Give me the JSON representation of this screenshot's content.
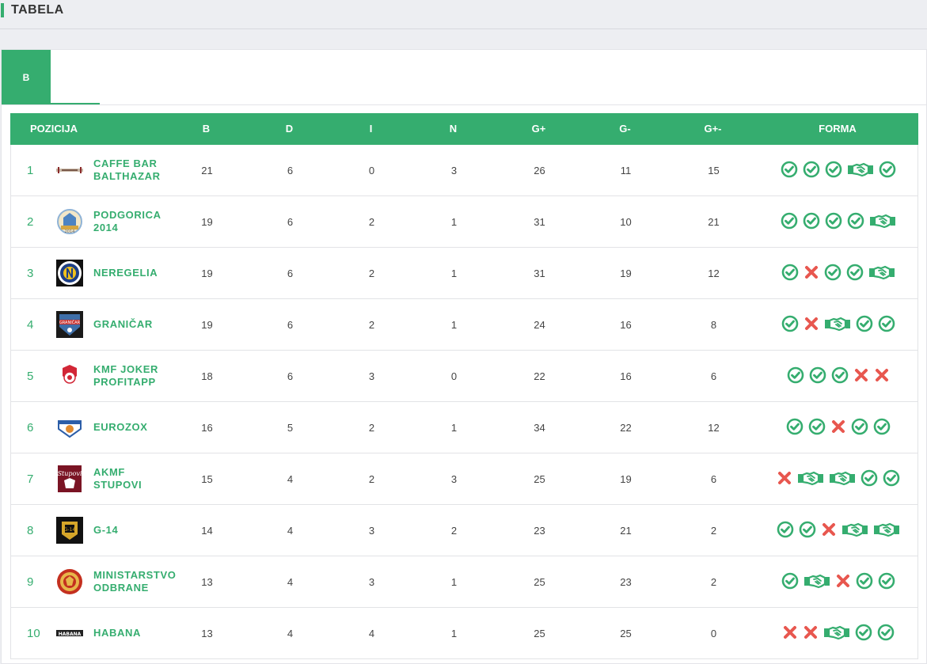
{
  "header": {
    "title": "TABELA"
  },
  "tabs": [
    {
      "label": "B"
    }
  ],
  "columns": [
    "POZICIJA",
    "B",
    "D",
    "I",
    "N",
    "G+",
    "G-",
    "G+-",
    "FORMA"
  ],
  "rows": [
    {
      "pos": "1",
      "name_l1": "CAFFE BAR",
      "name_l2": "BALTHAZAR",
      "logo": "caffe-bar-balthazar-logo",
      "b": "21",
      "d": "6",
      "i": "0",
      "n": "3",
      "gp": "26",
      "gm": "11",
      "gd": "15",
      "form": [
        "win",
        "win",
        "win",
        "draw",
        "win"
      ]
    },
    {
      "pos": "2",
      "name_l1": "PODGORICA",
      "name_l2": "2014",
      "logo": "podgorica-2014-logo",
      "b": "19",
      "d": "6",
      "i": "2",
      "n": "1",
      "gp": "31",
      "gm": "10",
      "gd": "21",
      "form": [
        "win",
        "win",
        "win",
        "win",
        "draw"
      ]
    },
    {
      "pos": "3",
      "name_l1": "NEREGELIA",
      "name_l2": "",
      "logo": "neregelia-logo",
      "b": "19",
      "d": "6",
      "i": "2",
      "n": "1",
      "gp": "31",
      "gm": "19",
      "gd": "12",
      "form": [
        "win",
        "loss",
        "win",
        "win",
        "draw"
      ]
    },
    {
      "pos": "4",
      "name_l1": "GRANIČAR",
      "name_l2": "",
      "logo": "granicar-logo",
      "b": "19",
      "d": "6",
      "i": "2",
      "n": "1",
      "gp": "24",
      "gm": "16",
      "gd": "8",
      "form": [
        "win",
        "loss",
        "draw",
        "win",
        "win"
      ]
    },
    {
      "pos": "5",
      "name_l1": "KMF JOKER",
      "name_l2": "PROFITAPP",
      "logo": "kmf-joker-logo",
      "b": "18",
      "d": "6",
      "i": "3",
      "n": "0",
      "gp": "22",
      "gm": "16",
      "gd": "6",
      "form": [
        "win",
        "win",
        "win",
        "loss",
        "loss"
      ]
    },
    {
      "pos": "6",
      "name_l1": "EUROZOX",
      "name_l2": "",
      "logo": "eurozox-logo",
      "b": "16",
      "d": "5",
      "i": "2",
      "n": "1",
      "gp": "34",
      "gm": "22",
      "gd": "12",
      "form": [
        "win",
        "win",
        "loss",
        "win",
        "win"
      ]
    },
    {
      "pos": "7",
      "name_l1": "AKMF",
      "name_l2": "STUPOVI",
      "logo": "akmf-stupovi-logo",
      "b": "15",
      "d": "4",
      "i": "2",
      "n": "3",
      "gp": "25",
      "gm": "19",
      "gd": "6",
      "form": [
        "loss",
        "draw",
        "draw",
        "win",
        "win"
      ]
    },
    {
      "pos": "8",
      "name_l1": "G-14",
      "name_l2": "",
      "logo": "g14-logo",
      "b": "14",
      "d": "4",
      "i": "3",
      "n": "2",
      "gp": "23",
      "gm": "21",
      "gd": "2",
      "form": [
        "win",
        "win",
        "loss",
        "draw",
        "draw"
      ]
    },
    {
      "pos": "9",
      "name_l1": "MINISTARSTVO",
      "name_l2": "ODBRANE",
      "logo": "ministarstvo-odbrane-logo",
      "b": "13",
      "d": "4",
      "i": "3",
      "n": "1",
      "gp": "25",
      "gm": "23",
      "gd": "2",
      "form": [
        "win",
        "draw",
        "loss",
        "win",
        "win"
      ]
    },
    {
      "pos": "10",
      "name_l1": "HABANA",
      "name_l2": "",
      "logo": "habana-logo",
      "b": "13",
      "d": "4",
      "i": "4",
      "n": "1",
      "gp": "25",
      "gm": "25",
      "gd": "0",
      "form": [
        "loss",
        "loss",
        "draw",
        "win",
        "win"
      ]
    }
  ],
  "colors": {
    "accent": "#35ad6f",
    "loss": "#e8574f",
    "text": "#444444"
  }
}
